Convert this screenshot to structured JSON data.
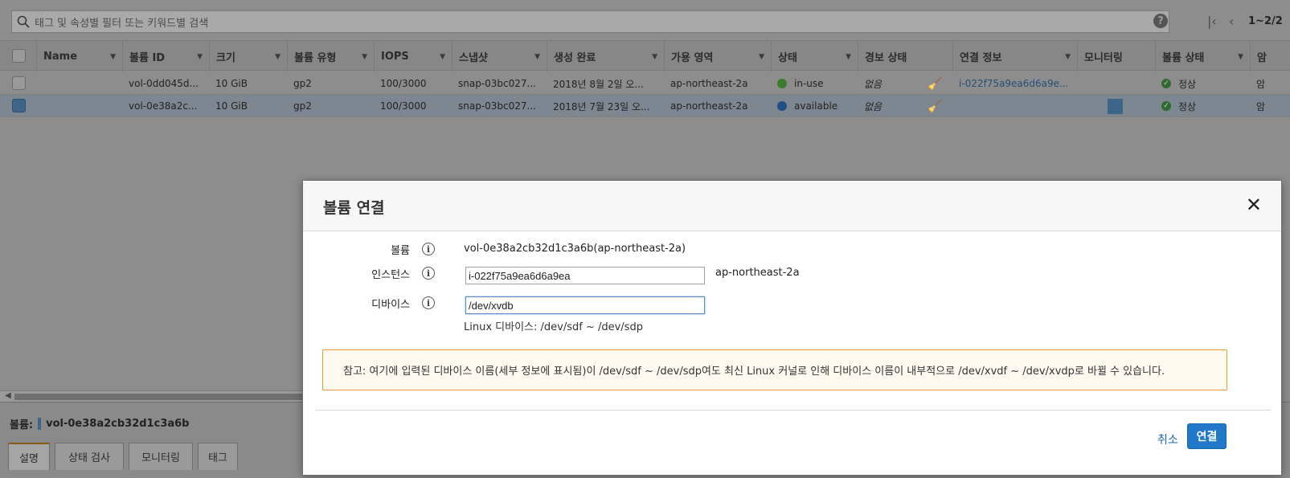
{
  "search": {
    "placeholder": "태그 및 속성별 필터 또는 키워드별 검색"
  },
  "pagination": {
    "range": "1~2/2"
  },
  "table": {
    "headers": [
      "Name",
      "볼륨 ID",
      "크기",
      "볼륨 유형",
      "IOPS",
      "스냅샷",
      "생성 완료",
      "가용 영역",
      "상태",
      "경보 상태",
      "연결 정보",
      "모니터링",
      "볼륨 상태",
      "암"
    ],
    "rows": [
      {
        "name": "",
        "volume_id": "vol-0dd045d...",
        "size": "10 GiB",
        "type": "gp2",
        "iops": "100/3000",
        "snapshot": "snap-03bc027...",
        "created": "2018년 8월 2일 오...",
        "az": "ap-northeast-2a",
        "state": "in-use",
        "state_color": "#3a7d2a",
        "alarm": "없음",
        "attachment": "i-022f75a9ea6d6a9e...",
        "volume_status": "정상",
        "encryption": "암"
      },
      {
        "name": "",
        "volume_id": "vol-0e38a2c...",
        "size": "10 GiB",
        "type": "gp2",
        "iops": "100/3000",
        "snapshot": "snap-03bc027...",
        "created": "2018년 7월 23일 오...",
        "az": "ap-northeast-2a",
        "state": "available",
        "state_color": "#1f4f86",
        "alarm": "없음",
        "attachment": "",
        "volume_status": "정상",
        "encryption": "암"
      }
    ]
  },
  "detail": {
    "label": "볼륨:",
    "volume_id": "vol-0e38a2cb32d1c3a6b"
  },
  "tabs": [
    "설명",
    "상태 검사",
    "모니터링",
    "태그"
  ],
  "modal": {
    "title": "볼륨 연결",
    "close": "✕",
    "volume_label": "볼륨",
    "volume_value": "vol-0e38a2cb32d1c3a6b(ap-northeast-2a)",
    "instance_label": "인스턴스",
    "instance_value": "i-022f75a9ea6d6a9ea",
    "instance_az": "ap-northeast-2a",
    "device_label": "디바이스",
    "device_value": "/dev/xvdb",
    "device_hint": "Linux 디바이스: /dev/sdf ~ /dev/sdp",
    "note": "참고: 여기에 입력된 디바이스 이름(세부 정보에 표시됨)이 /dev/sdf ~ /dev/sdp여도 최신 Linux 커널로 인해 디바이스 이름이 내부적으로 /dev/xvdf ~ /dev/xvdp로 바뀔 수 있습니다.",
    "cancel": "취소",
    "attach": "연결",
    "info_glyph": "i"
  }
}
